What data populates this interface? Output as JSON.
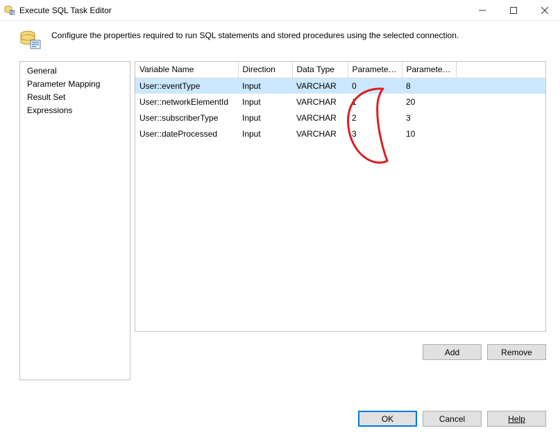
{
  "window": {
    "title": "Execute SQL Task Editor",
    "description": "Configure the properties required to run SQL statements and stored procedures using the selected connection."
  },
  "nav": {
    "items": [
      {
        "label": "General"
      },
      {
        "label": "Parameter Mapping"
      },
      {
        "label": "Result Set"
      },
      {
        "label": "Expressions"
      }
    ]
  },
  "grid": {
    "columns": [
      "Variable Name",
      "Direction",
      "Data Type",
      "Parameter ...",
      "Parameter ..."
    ],
    "widths": [
      148,
      78,
      80,
      78,
      78
    ],
    "rows": [
      {
        "variable": "User::eventType",
        "direction": "Input",
        "datatype": "VARCHAR",
        "paramName": "0",
        "paramSize": "8",
        "selected": true
      },
      {
        "variable": "User::networkElementId",
        "direction": "Input",
        "datatype": "VARCHAR",
        "paramName": "1",
        "paramSize": "20",
        "selected": false
      },
      {
        "variable": "User::subscriberType",
        "direction": "Input",
        "datatype": "VARCHAR",
        "paramName": "2",
        "paramSize": "3",
        "selected": false
      },
      {
        "variable": "User::dateProcessed",
        "direction": "Input",
        "datatype": "VARCHAR",
        "paramName": "3",
        "paramSize": "10",
        "selected": false
      }
    ]
  },
  "buttons": {
    "add": "Add",
    "remove": "Remove",
    "ok": "OK",
    "cancel": "Cancel",
    "help": "Help"
  }
}
